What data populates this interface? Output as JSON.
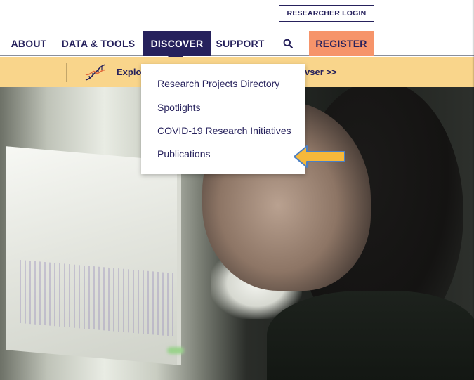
{
  "header": {
    "login_label": "RESEARCHER LOGIN"
  },
  "nav": {
    "items": [
      {
        "label": "ABOUT"
      },
      {
        "label": "DATA & TOOLS"
      },
      {
        "label": "DISCOVER",
        "active": true
      },
      {
        "label": "SUPPORT"
      }
    ],
    "search_icon": "search-icon",
    "register_label": "REGISTER"
  },
  "banner": {
    "icon": "dna-icon",
    "text_left": "Explo",
    "text_right": "vser >>"
  },
  "dropdown": {
    "items": [
      {
        "label": "Research Projects Directory"
      },
      {
        "label": "Spotlights"
      },
      {
        "label": "COVID-19 Research Initiatives"
      },
      {
        "label": "Publications"
      }
    ]
  },
  "annotation": {
    "icon": "arrow-left-icon",
    "fill_color": "#f6b83a",
    "outline_color": "#4b7fc4"
  },
  "colors": {
    "brand_navy": "#26215c",
    "register_orange": "#f6946a",
    "banner_yellow": "#f9d58b"
  }
}
